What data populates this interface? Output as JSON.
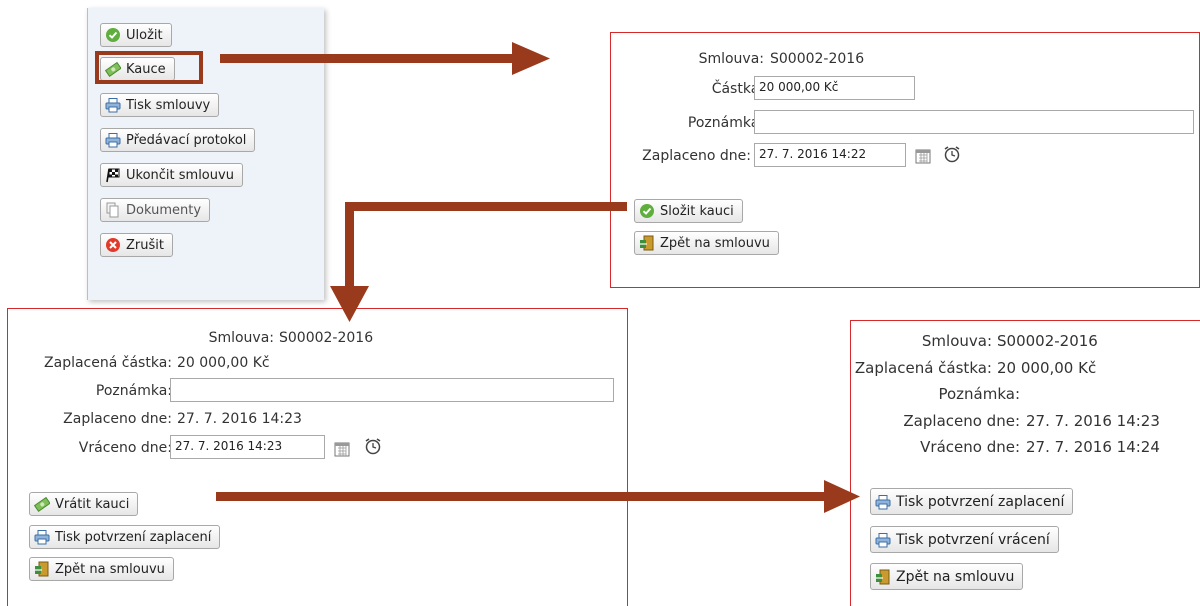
{
  "toolbar": {
    "save": "Uložit",
    "deposit": "Kauce",
    "print_contract": "Tisk smlouvy",
    "handover_protocol": "Předávací protokol",
    "end_contract": "Ukončit smlouvu",
    "documents": "Dokumenty",
    "cancel": "Zrušit"
  },
  "dialog1": {
    "contract_label": "Smlouva:",
    "contract_value": "S00002-2016",
    "amount_label": "Částka:",
    "amount_value": "20 000,00 Kč",
    "note_label": "Poznámka:",
    "note_value": "",
    "paid_label": "Zaplaceno dne:",
    "paid_value": "27. 7. 2016 14:22",
    "deposit_button": "Složit kauci",
    "back_button": "Zpět na smlouvu"
  },
  "dialog2": {
    "contract_label": "Smlouva:",
    "contract_value": "S00002-2016",
    "paid_amount_label": "Zaplacená částka:",
    "paid_amount_value": "20 000,00 Kč",
    "note_label": "Poznámka:",
    "note_value": "",
    "paid_label": "Zaplaceno dne:",
    "paid_value": "27. 7. 2016 14:23",
    "returned_label": "Vráceno dne:",
    "returned_value": "27. 7. 2016 14:23",
    "return_button": "Vrátit kauci",
    "print_payment_button": "Tisk potvrzení zaplacení",
    "back_button": "Zpět na smlouvu"
  },
  "dialog3": {
    "contract_label": "Smlouva:",
    "contract_value": "S00002-2016",
    "paid_amount_label": "Zaplacená částka:",
    "paid_amount_value": "20 000,00 Kč",
    "note_label": "Poznámka:",
    "note_value": "",
    "paid_label": "Zaplaceno dne:",
    "paid_value": "27. 7. 2016 14:23",
    "returned_label": "Vráceno dne:",
    "returned_value": "27. 7. 2016 14:24",
    "print_payment_button": "Tisk potvrzení zaplacení",
    "print_return_button": "Tisk potvrzení vrácení",
    "back_button": "Zpět na smlouvu"
  },
  "colors": {
    "arrow": "#9a3a1c",
    "dialog_border": "#d62a2a",
    "panel_bg": "#eef3fa"
  }
}
